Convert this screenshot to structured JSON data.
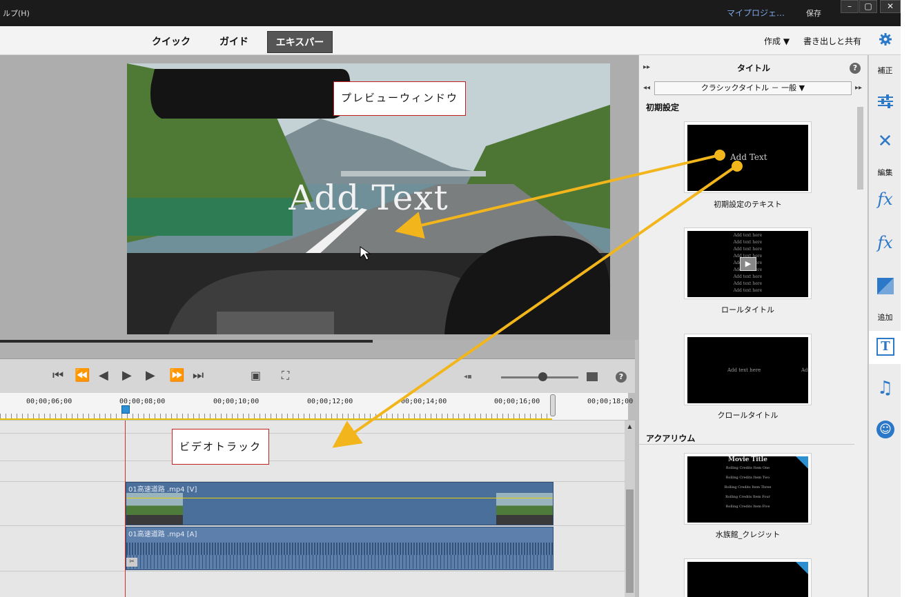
{
  "titlebar": {
    "menu": "ルプ(H)",
    "project": "マイプロジェ…",
    "save": "保存",
    "btn_min": "–",
    "btn_max": "▢",
    "btn_close": "✕"
  },
  "modes": {
    "quick": "クイック",
    "guided": "ガイド",
    "expert": "エキスパート"
  },
  "topbar": {
    "create": "作成 ▼",
    "share": "書き出しと共有"
  },
  "preview": {
    "overlay_text": "Add Text",
    "callout": "プレビューウィンドウ"
  },
  "timeline": {
    "timecodes": [
      "00;00;06;00",
      "00;00;08;00",
      "00;00;10;00",
      "00;00;12;00",
      "00;00;14;00",
      "00;00;16;00",
      "00;00;18;00"
    ],
    "video_clip": "01高速道路 .mp4 [V]",
    "audio_clip": "01高速道路 .mp4 [A]",
    "callout": "ビデオトラック"
  },
  "panel": {
    "title": "タイトル",
    "dropdown": "クラシックタイトル － 一般 ▼",
    "section_default": "初期設定",
    "section_aquarium": "アクアリウム",
    "thumb1_text": "Add Text",
    "thumb1_label": "初期設定のテキスト",
    "thumb2_lines": [
      "Add text here",
      "Add text here",
      "Add text here",
      "Add text here",
      "Add text here",
      "Add text here",
      "Add text here",
      "Add text here",
      "Add text here"
    ],
    "thumb2_label": "ロールタイトル",
    "thumb3_text": "Add text here",
    "thumb3_text2": "Add",
    "thumb3_label": "クロールタイトル",
    "thumb4_title": "Movie Title",
    "thumb4_lines": [
      "Rolling Credits Item One",
      "Rolling Credits Item Two",
      "Rolling Credits Item Three",
      "Rolling Credits Item Four",
      "Rolling Credits Item Five"
    ],
    "thumb4_label": "水族館_クレジット"
  },
  "rightbar": {
    "adjust": "補正",
    "edit": "編集",
    "add": "追加"
  },
  "colors": {
    "accent": "#2c78c8",
    "arrow": "#f2b61c",
    "clip": "#4a6f9a"
  }
}
